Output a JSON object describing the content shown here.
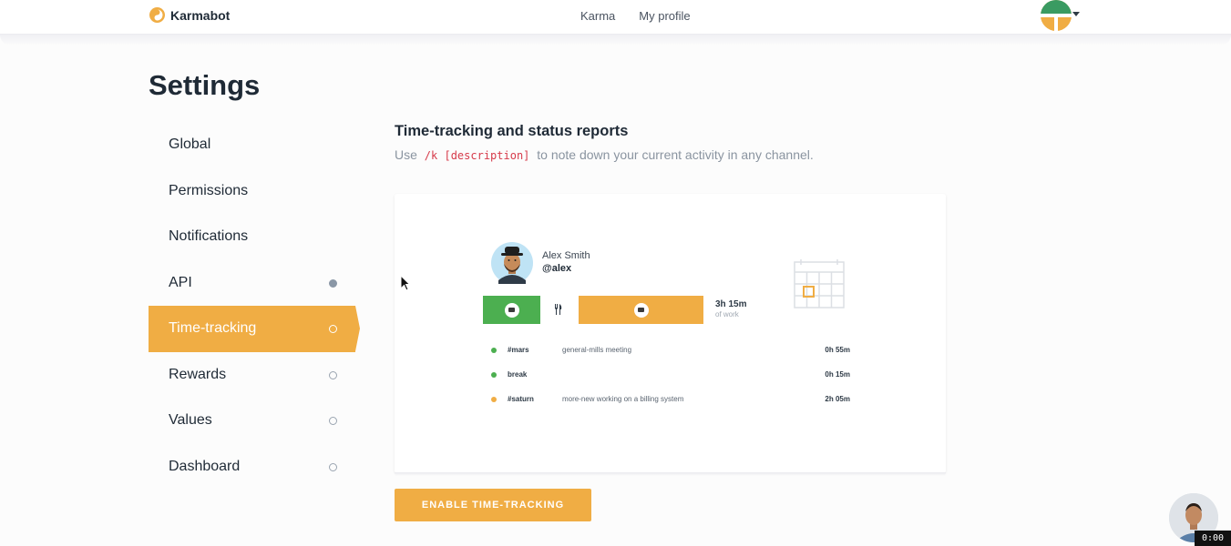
{
  "brand": {
    "name": "Karmabot"
  },
  "nav": {
    "items": [
      {
        "label": "Karma"
      },
      {
        "label": "My profile"
      }
    ]
  },
  "page": {
    "title": "Settings"
  },
  "sidebar": {
    "items": [
      {
        "label": "Global"
      },
      {
        "label": "Permissions"
      },
      {
        "label": "Notifications"
      },
      {
        "label": "API"
      },
      {
        "label": "Time-tracking"
      },
      {
        "label": "Rewards"
      },
      {
        "label": "Values"
      },
      {
        "label": "Dashboard"
      }
    ],
    "active": "Time-tracking"
  },
  "section": {
    "title": "Time-tracking and status reports",
    "desc_before": "Use",
    "command": "/k [description]",
    "desc_after": "to note down your current activity in any channel."
  },
  "preview": {
    "user_name": "Alex Smith",
    "user_handle": "@alex",
    "total_time": "3h 15m",
    "total_label": "of work",
    "entries": [
      {
        "channel": "#mars",
        "description": "general-mills meeting",
        "time": "0h 55m",
        "color": "#4caf50"
      },
      {
        "channel": "break",
        "description": "",
        "time": "0h 15m",
        "color": "#4caf50"
      },
      {
        "channel": "#saturn",
        "description": "more-new working on a billing system",
        "time": "2h 05m",
        "color": "#f0ad44"
      }
    ]
  },
  "actions": {
    "enable_label": "ENABLE TIME-TRACKING"
  },
  "timer": {
    "value": "0:00"
  },
  "colors": {
    "accent": "#f0ad44",
    "green": "#4caf50",
    "text": "#1f2a36",
    "muted": "#8a94a0",
    "code": "#d63a4a"
  },
  "icons": [
    "karmabot-logo-icon",
    "user-avatar-icon",
    "briefcase-icon",
    "fork-knife-icon",
    "calendar-icon",
    "mouse-cursor-icon",
    "support-avatar-icon"
  ]
}
